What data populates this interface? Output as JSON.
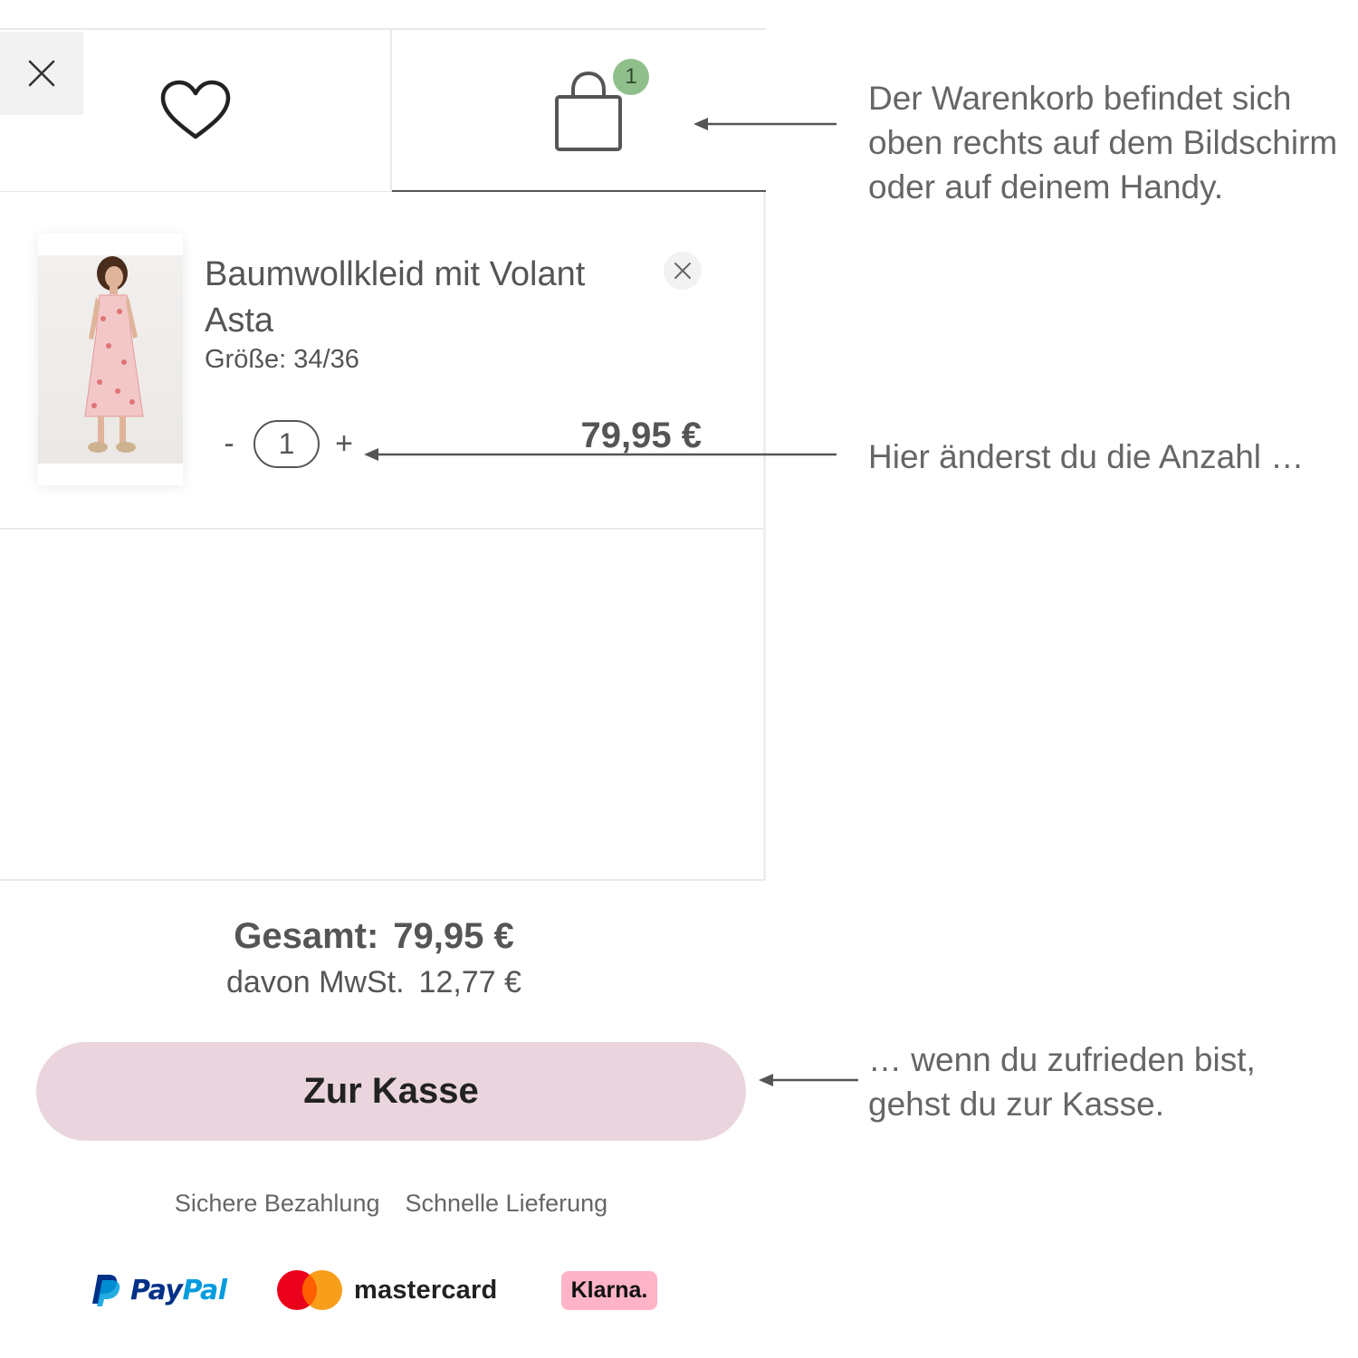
{
  "header": {
    "close_icon": "close-icon",
    "wishlist_icon": "heart-icon",
    "cart_icon": "shopping-bag-icon",
    "cart_count": "1"
  },
  "cart": {
    "item": {
      "name": "Baumwollkleid mit Volant Asta",
      "size": "Größe: 34/36",
      "quantity": "1",
      "minus": "-",
      "plus": "+",
      "price": "79,95 €",
      "image": "dress-photo"
    }
  },
  "summary": {
    "total_label": "Gesamt:",
    "total_value": "79,95 €",
    "vat_label": "davon MwSt.",
    "vat_value": "12,77 €"
  },
  "checkout": {
    "label": "Zur Kasse"
  },
  "trust": {
    "secure_payment": "Sichere Bezahlung",
    "fast_delivery": "Schnelle Lieferung"
  },
  "payments": {
    "paypal": "PayPal",
    "mastercard": "mastercard",
    "klarna": "Klarna."
  },
  "annotations": {
    "cart_note": "Der Warenkorb befindet sich oben rechts auf dem Bildschirm oder auf deinem Handy.",
    "quantity_note": "Hier änderst du die Anzahl …",
    "checkout_note": "… wenn du zufrieden bist, gehst du zur Kasse."
  },
  "colors": {
    "badge": "#8fbf8a",
    "checkout_button": "#ead5df",
    "klarna": "#ffb3c7",
    "paypal_dark": "#003087",
    "paypal_light": "#009cde",
    "mastercard_red": "#eb001b",
    "mastercard_orange": "#f79e1b",
    "text": "#555555"
  }
}
